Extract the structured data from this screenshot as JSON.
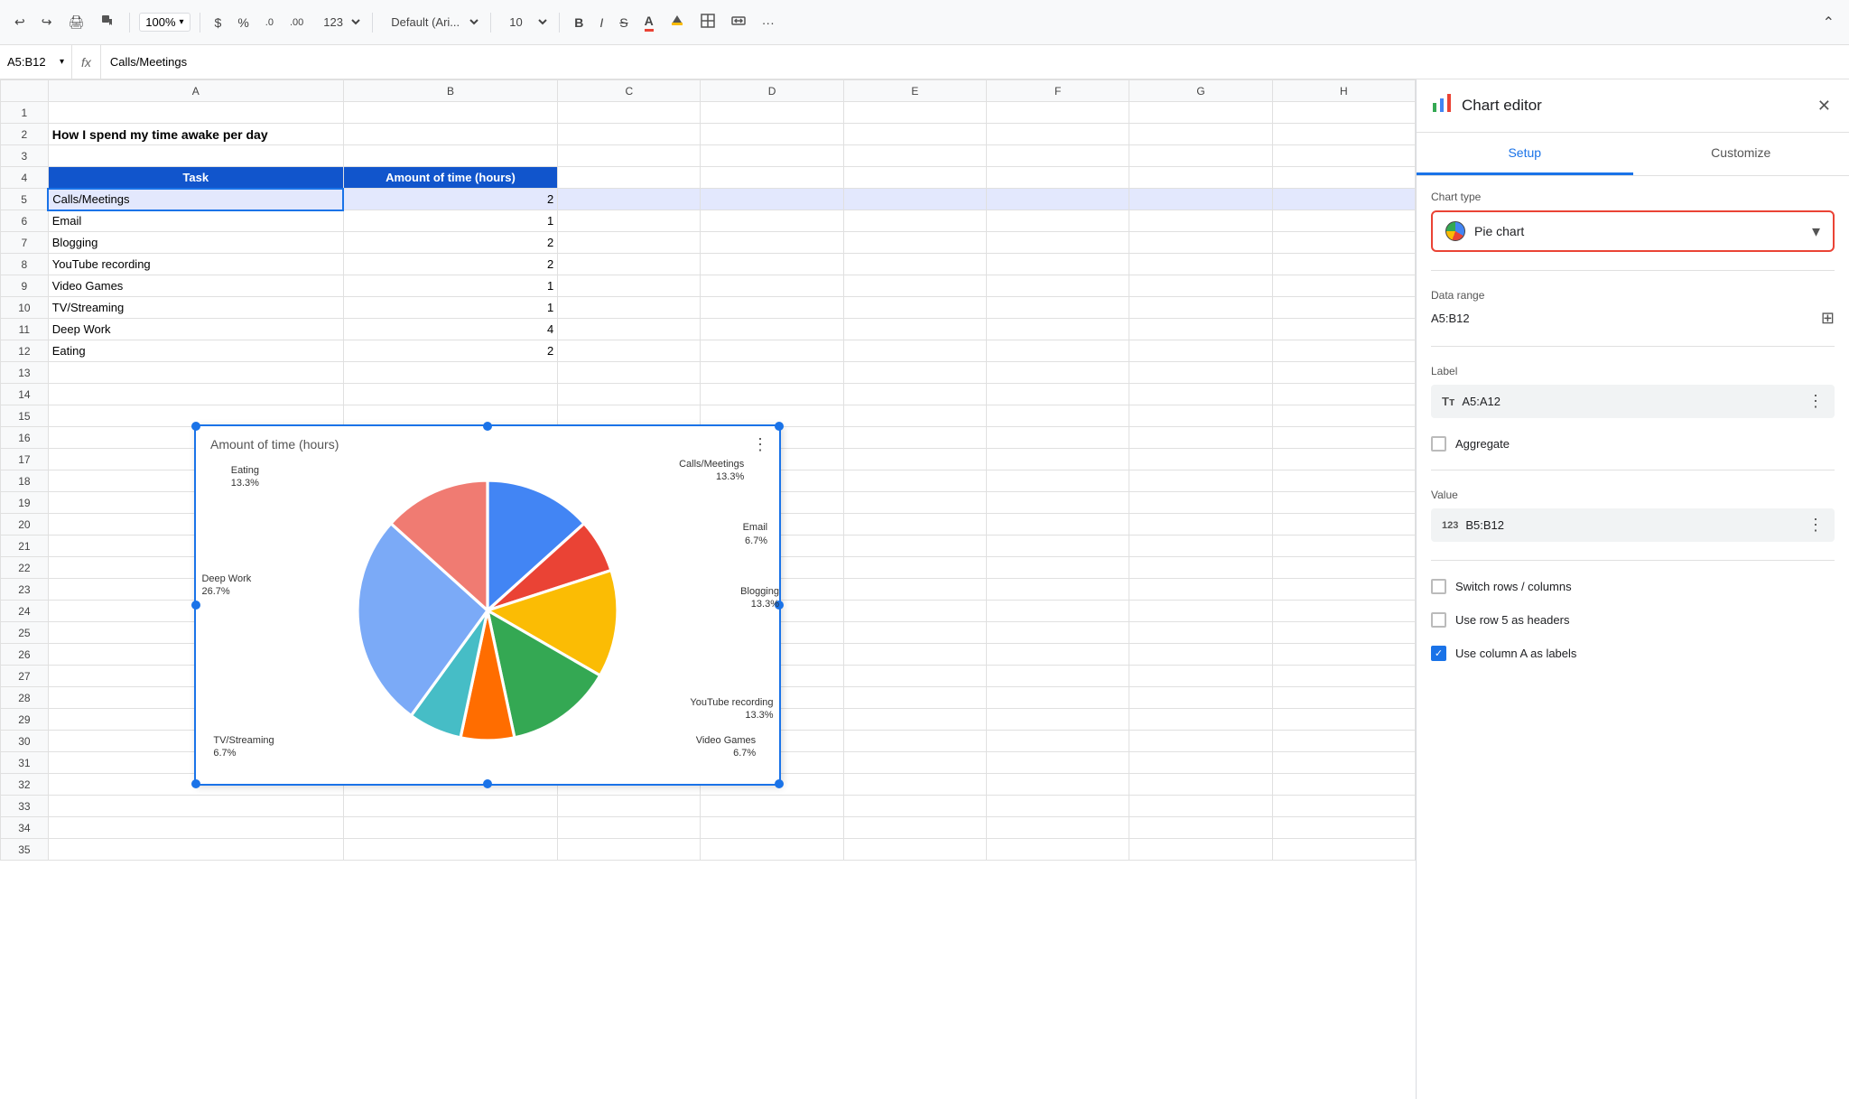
{
  "toolbar": {
    "undo": "↩",
    "redo": "↪",
    "print": "🖨",
    "paint_format": "🪣",
    "zoom": "100%",
    "currency": "$",
    "percent": "%",
    "decimal_0": ".0",
    "decimal_00": ".00",
    "format_num": "123",
    "font_family": "Default (Ari...",
    "font_size": "10",
    "bold": "B",
    "italic": "I",
    "strikethrough": "S̶",
    "font_color": "A",
    "fill_color": "🪣",
    "borders": "⊞",
    "merge": "⊟",
    "more": "···",
    "collapse": "⌃"
  },
  "formula_bar": {
    "cell_ref": "A5:B12",
    "fx": "fx",
    "formula": "Calls/Meetings"
  },
  "columns": [
    "A",
    "B",
    "C",
    "D",
    "E",
    "F",
    "G",
    "H"
  ],
  "rows": [
    {
      "num": 1,
      "a": "",
      "b": "",
      "c": "",
      "d": "",
      "e": "",
      "f": "",
      "g": "",
      "h": ""
    },
    {
      "num": 2,
      "a": "How I spend my time awake per day",
      "b": "",
      "c": "",
      "d": "",
      "e": "",
      "f": "",
      "g": "",
      "h": ""
    },
    {
      "num": 3,
      "a": "",
      "b": "",
      "c": "",
      "d": "",
      "e": "",
      "f": "",
      "g": "",
      "h": ""
    },
    {
      "num": 4,
      "a": "Task",
      "b": "Amount of time (hours)",
      "c": "",
      "d": "",
      "e": "",
      "f": "",
      "g": "",
      "h": "",
      "header": true
    },
    {
      "num": 5,
      "a": "Calls/Meetings",
      "b": "2",
      "selected": true
    },
    {
      "num": 6,
      "a": "Email",
      "b": "1"
    },
    {
      "num": 7,
      "a": "Blogging",
      "b": "2"
    },
    {
      "num": 8,
      "a": "YouTube recording",
      "b": "2"
    },
    {
      "num": 9,
      "a": "Video Games",
      "b": "1"
    },
    {
      "num": 10,
      "a": "TV/Streaming",
      "b": "1"
    },
    {
      "num": 11,
      "a": "Deep Work",
      "b": "4"
    },
    {
      "num": 12,
      "a": "Eating",
      "b": "2"
    },
    {
      "num": 13,
      "a": ""
    },
    {
      "num": 14,
      "a": ""
    },
    {
      "num": 15,
      "a": ""
    },
    {
      "num": 16,
      "a": ""
    },
    {
      "num": 17,
      "a": ""
    },
    {
      "num": 18,
      "a": ""
    },
    {
      "num": 19,
      "a": ""
    },
    {
      "num": 20,
      "a": ""
    },
    {
      "num": 21,
      "a": ""
    },
    {
      "num": 22,
      "a": ""
    },
    {
      "num": 23,
      "a": ""
    },
    {
      "num": 24,
      "a": ""
    },
    {
      "num": 25,
      "a": ""
    },
    {
      "num": 26,
      "a": ""
    },
    {
      "num": 27,
      "a": ""
    },
    {
      "num": 28,
      "a": ""
    },
    {
      "num": 29,
      "a": ""
    },
    {
      "num": 30,
      "a": ""
    },
    {
      "num": 31,
      "a": ""
    },
    {
      "num": 32,
      "a": ""
    },
    {
      "num": 33,
      "a": ""
    },
    {
      "num": 34,
      "a": ""
    },
    {
      "num": 35,
      "a": ""
    }
  ],
  "chart": {
    "title": "Amount of time (hours)",
    "slices": [
      {
        "label": "Calls/Meetings",
        "percent": "13.3%",
        "color": "#4285f4",
        "degrees": 48,
        "start": 0
      },
      {
        "label": "Email",
        "percent": "6.7%",
        "color": "#ea4335",
        "degrees": 24,
        "start": 48
      },
      {
        "label": "Blogging",
        "percent": "13.3%",
        "color": "#fbbc04",
        "degrees": 48,
        "start": 72
      },
      {
        "label": "YouTube recording",
        "percent": "13.3%",
        "color": "#34a853",
        "degrees": 48,
        "start": 120
      },
      {
        "label": "Video Games",
        "percent": "6.7%",
        "color": "#ff6d00",
        "degrees": 24,
        "start": 168
      },
      {
        "label": "TV/Streaming",
        "percent": "6.7%",
        "color": "#46bdc6",
        "degrees": 24,
        "start": 192
      },
      {
        "label": "Deep Work",
        "percent": "26.7%",
        "color": "#7baaf7",
        "degrees": 96,
        "start": 216
      },
      {
        "label": "Eating",
        "percent": "13.3%",
        "color": "#f07b72",
        "degrees": 48,
        "start": 312
      }
    ]
  },
  "chart_editor": {
    "title": "Chart editor",
    "close": "✕",
    "tabs": [
      "Setup",
      "Customize"
    ],
    "active_tab": "Setup",
    "chart_type_label": "Chart type",
    "chart_type_value": "Pie chart",
    "data_range_label": "Data range",
    "data_range_value": "A5:B12",
    "label_section": "Label",
    "label_range": "A5:A12",
    "aggregate_label": "Aggregate",
    "value_section": "Value",
    "value_range": "B5:B12",
    "switch_rows_cols": "Switch rows / columns",
    "use_row5": "Use row 5 as headers",
    "use_col_a": "Use column A as labels"
  }
}
